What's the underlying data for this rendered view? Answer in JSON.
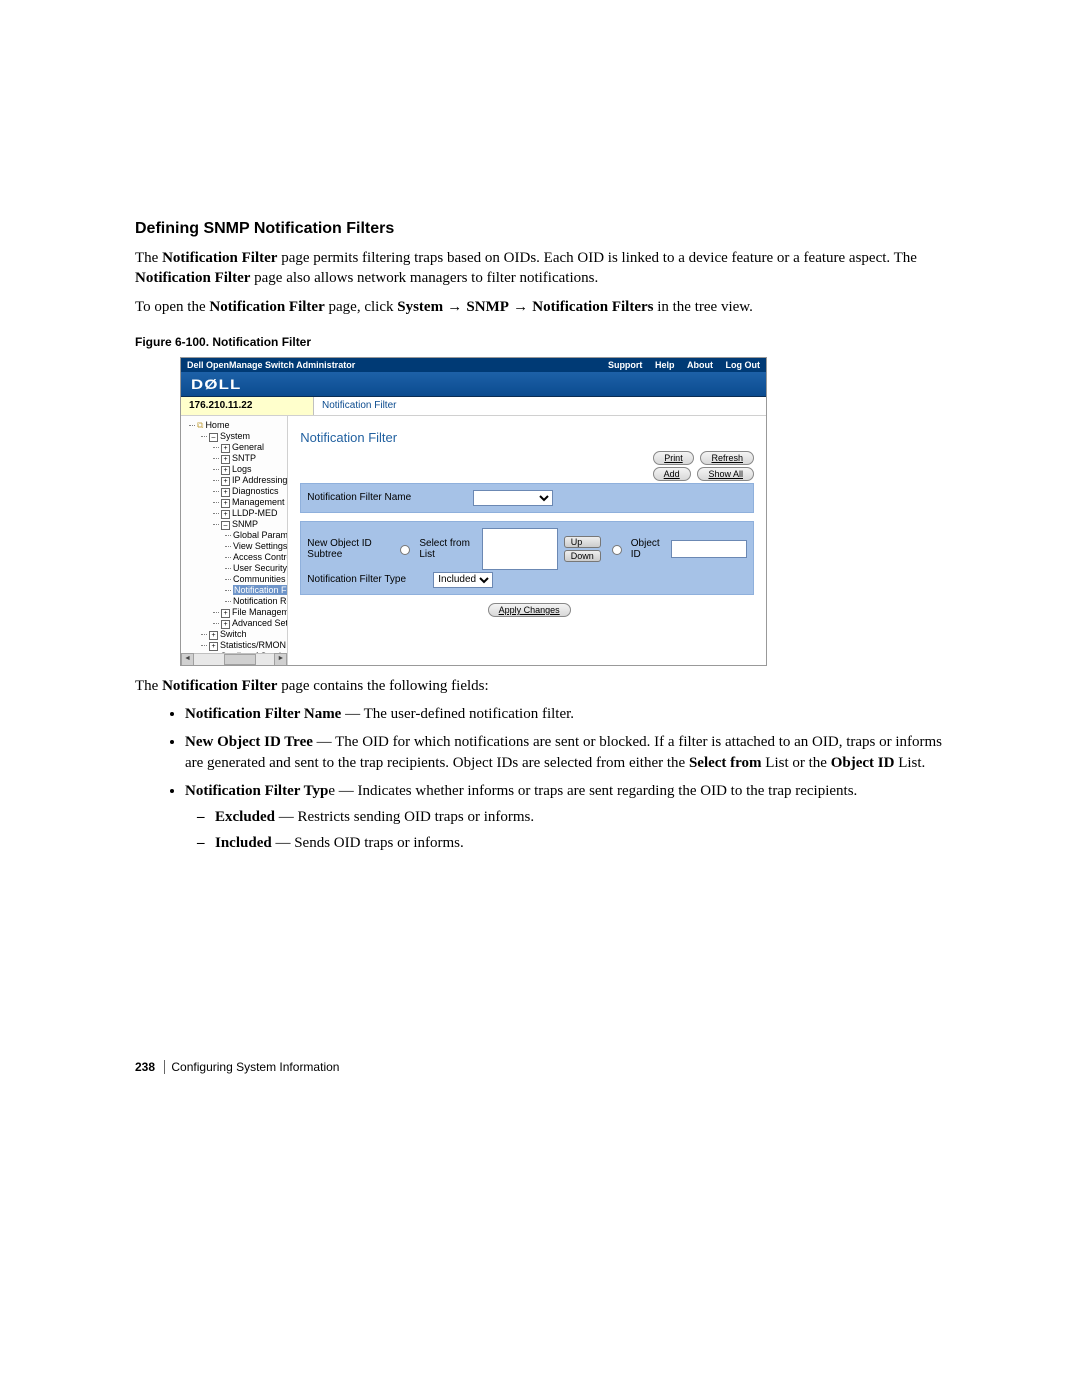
{
  "page": {
    "heading": "Defining SNMP Notification Filters",
    "para1_a": "The ",
    "para1_b": "Notification Filter",
    "para1_c": " page permits filtering traps based on OIDs. Each OID is linked to a device feature or a feature aspect. The ",
    "para1_d": "Notification Filter",
    "para1_e": " page also allows network managers to filter notifications.",
    "para2_a": "To open the ",
    "para2_b": "Notification Filter",
    "para2_c": " page, ",
    "para2_d": "click ",
    "para2_e": "System",
    "para2_f": "SNMP",
    "para2_g": "Notification Filters",
    "para2_h": " in the tree view.",
    "fig_caption": "Figure 6-100.    Notification Filter",
    "after1_a": "The ",
    "after1_b": "Notification Filter",
    "after1_c": " page contains the following fields:"
  },
  "fields": {
    "f1_b": "Notification Filter Name",
    "f1_t": " — The user-defined notification filter.",
    "f2_b": "New Object ID Tree",
    "f2_t1": " — The OID for which notifications are sent or blocked. If a filter is attached to an OID, traps or informs are generated and sent to the trap recipients. Object IDs are selected from either the ",
    "f2_b2": "Select from",
    "f2_t2": " List or the ",
    "f2_b3": "Object ID",
    "f2_t3": " List.",
    "f3_b": "Notification Filter Typ",
    "f3_t": "e — Indicates whether informs or traps are sent regarding the OID to the trap recipients.",
    "s1_b": "Excluded",
    "s1_t": " — Restricts sending OID traps or informs.",
    "s2_b": "Included",
    "s2_t": " — Sends OID traps or informs."
  },
  "ui": {
    "app_title": "Dell OpenManage Switch Administrator",
    "nav": {
      "support": "Support",
      "help": "Help",
      "about": "About",
      "logout": "Log Out"
    },
    "logo": "DØLL",
    "ip": "176.210.11.22",
    "breadcrumb": "Notification Filter",
    "page_title": "Notification Filter",
    "buttons": {
      "print": "Print",
      "refresh": "Refresh",
      "add": "Add",
      "showall": "Show All",
      "apply": "Apply Changes",
      "up": "Up",
      "down": "Down"
    },
    "labels": {
      "filter_name": "Notification Filter Name",
      "newoid": "New Object ID Subtree",
      "select_from": "Select from List",
      "object_id": "Object ID",
      "filter_type": "Notification Filter Type",
      "included": "Included"
    },
    "tree": {
      "home": "Home",
      "system": "System",
      "general": "General",
      "sntp": "SNTP",
      "logs": "Logs",
      "ip": "IP Addressing",
      "diag": "Diagnostics",
      "msec": "Management Security",
      "lldp": "LLDP-MED",
      "snmp": "SNMP",
      "gparams": "Global Parameters",
      "views": "View Settings",
      "access": "Access Control",
      "usm": "User Security Model",
      "comm": "Communities",
      "notif_filter": "Notification Filter",
      "notif_recip": "Notification Recipien",
      "filemgmt": "File Management",
      "adv": "Advanced Settings",
      "switch": "Switch",
      "stats": "Statistics/RMON",
      "qos": "Quality of Service"
    }
  },
  "footer": {
    "page_num": "238",
    "section": "Configuring System Information"
  }
}
